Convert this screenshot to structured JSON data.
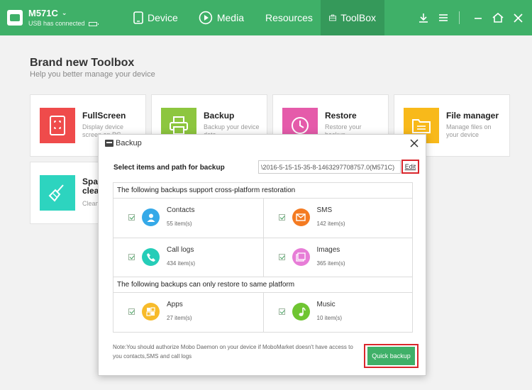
{
  "device": {
    "name": "M571C",
    "status": "USB has connected"
  },
  "nav": [
    {
      "label": "Device",
      "icon": "phone-icon"
    },
    {
      "label": "Media",
      "icon": "play-icon"
    },
    {
      "label": "Resources",
      "icon": "grid-icon"
    },
    {
      "label": "ToolBox",
      "icon": "toolbox-icon"
    }
  ],
  "active_tab": "ToolBox",
  "page": {
    "title": "Brand new Toolbox",
    "subtitle": "Help you better manage your device"
  },
  "tools": [
    {
      "name": "FullScreen",
      "desc": "Display device screen on PC",
      "color": "#ef4b4b",
      "icon": "fullscreen-icon"
    },
    {
      "name": "Backup",
      "desc": "Backup your device data",
      "color": "#8dc63f",
      "icon": "printer-icon"
    },
    {
      "name": "Restore",
      "desc": "Restore your backup",
      "color": "#e55baa",
      "icon": "clock-icon"
    },
    {
      "name": "File manager",
      "desc": "Manage files on your device",
      "color": "#f8b91a",
      "icon": "folder-icon"
    },
    {
      "name": "Spa clea",
      "desc": "Clean",
      "color": "#2dd4bf",
      "icon": "broom-icon"
    }
  ],
  "dialog": {
    "title": "Backup",
    "select_label": "Select items and path for backup",
    "path_value": "\\2016-5-15-15-35-8-1463297708757.0(M571C)",
    "edit_label": "Edit",
    "section1_title": "The following backups support cross-platform restoration",
    "section2_title": "The following backups can only restore to same platform",
    "items_cross": [
      {
        "name": "Contacts",
        "count": "55 item(s)",
        "color": "#35a9e8",
        "icon": "contacts-icon"
      },
      {
        "name": "SMS",
        "count": "142 item(s)",
        "color": "#f47b22",
        "icon": "sms-icon"
      },
      {
        "name": "Call logs",
        "count": "434 item(s)",
        "color": "#25cdb8",
        "icon": "phone-call-icon"
      },
      {
        "name": "Images",
        "count": "365 item(s)",
        "color": "#e77dd7",
        "icon": "images-icon"
      }
    ],
    "items_same": [
      {
        "name": "Apps",
        "count": "27 item(s)",
        "color": "#f7bb2b",
        "icon": "apps-icon"
      },
      {
        "name": "Music",
        "count": "10 item(s)",
        "color": "#6fc532",
        "icon": "music-icon"
      }
    ],
    "note": "Note:You should authorize Mobo Daemon on your device if MoboMarket doesn't have access to you contacts,SMS and call logs",
    "quick_backup_label": "Quick backup"
  }
}
